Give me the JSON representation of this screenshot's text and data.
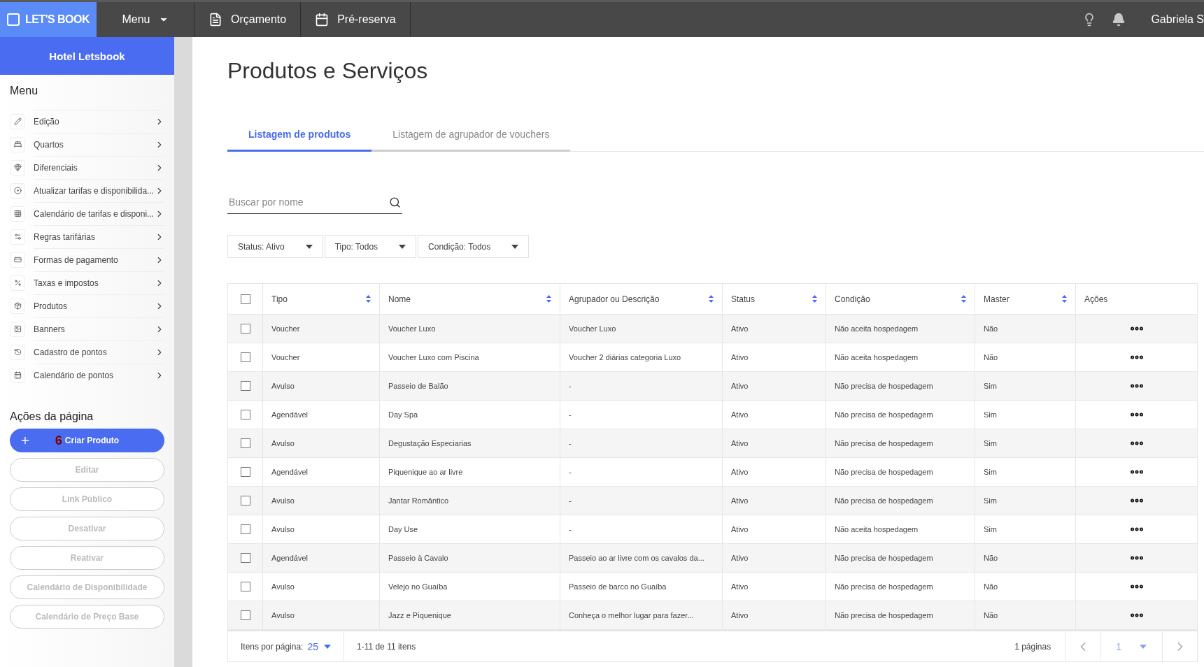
{
  "topbar": {
    "logo": "LET'S BOOK",
    "menu": "Menu",
    "nav": [
      {
        "label": "Orçamento"
      },
      {
        "label": "Pré-reserva"
      }
    ],
    "user": "Gabriela S"
  },
  "sidebar": {
    "hotel": "Hotel Letsbook",
    "menu_title": "Menu",
    "items": [
      {
        "label": "Edição"
      },
      {
        "label": "Quartos"
      },
      {
        "label": "Diferenciais"
      },
      {
        "label": "Atualizar tarifas e disponibilida..."
      },
      {
        "label": "Calendário de tarifas e disponi..."
      },
      {
        "label": "Regras tarifárias"
      },
      {
        "label": "Formas de pagamento"
      },
      {
        "label": "Taxas e impostos"
      },
      {
        "label": "Produtos"
      },
      {
        "label": "Banners"
      },
      {
        "label": "Cadastro de pontos"
      },
      {
        "label": "Calendário de pontos"
      }
    ],
    "actions_title": "Ações da página",
    "actions": [
      {
        "kind": "primary",
        "label": "Criar Produto",
        "marker": "6"
      },
      {
        "kind": "outline",
        "label": "Editar",
        "disabled": true
      },
      {
        "kind": "outline",
        "label": "Link Público",
        "disabled": true
      },
      {
        "kind": "outline",
        "label": "Desativar",
        "disabled": true
      },
      {
        "kind": "outline",
        "label": "Reativar",
        "disabled": true
      },
      {
        "kind": "outline",
        "label": "Calendário de Disponibilidade",
        "disabled": true
      },
      {
        "kind": "outline",
        "label": "Calendário de Preço Base",
        "disabled": true
      }
    ]
  },
  "page": {
    "title": "Produtos e Serviços",
    "tabs": [
      {
        "label": "Listagem de produtos",
        "selected": true
      },
      {
        "label": "Listagem de agrupador de vouchers",
        "selected": false
      }
    ],
    "search": {
      "placeholder": "Buscar por nome"
    },
    "filters": [
      {
        "label": "Status: Ativo"
      },
      {
        "label": "Tipo: Todos"
      },
      {
        "label": "Condição: Todos"
      }
    ],
    "table": {
      "columns": [
        {
          "label": "Tipo",
          "sortable": true
        },
        {
          "label": "Nome",
          "sortable": true
        },
        {
          "label": "Agrupador ou Descrição",
          "sortable": true
        },
        {
          "label": "Status",
          "sortable": true
        },
        {
          "label": "Condição",
          "sortable": true
        },
        {
          "label": "Master",
          "sortable": true
        },
        {
          "label": "Ações",
          "sortable": false
        }
      ],
      "all_checked": false,
      "rows": [
        {
          "checked": false,
          "cells": [
            "Voucher",
            "Voucher Luxo",
            "Voucher Luxo",
            "Ativo",
            "Não aceita hospedagem",
            "Não"
          ]
        },
        {
          "checked": false,
          "cells": [
            "Voucher",
            "Voucher Luxo com Piscina",
            "Voucher 2 diárias categoria Luxo",
            "Ativo",
            "Não aceita hospedagem",
            "Não"
          ]
        },
        {
          "checked": false,
          "cells": [
            "Avulso",
            "Passeio de Balão",
            "-",
            "Ativo",
            "Não precisa de hospedagem",
            "Sim"
          ]
        },
        {
          "checked": false,
          "cells": [
            "Agendável",
            "Day Spa",
            "-",
            "Ativo",
            "Não precisa de hospedagem",
            "Sim"
          ]
        },
        {
          "checked": false,
          "cells": [
            "Avulso",
            "Degustação Especiarias",
            "-",
            "Ativo",
            "Não precisa de hospedagem",
            "Sim"
          ]
        },
        {
          "checked": false,
          "cells": [
            "Agendável",
            "Piquenique ao ar livre",
            "-",
            "Ativo",
            "Não precisa de hospedagem",
            "Sim"
          ]
        },
        {
          "checked": false,
          "cells": [
            "Avulso",
            "Jantar Romântico",
            "-",
            "Ativo",
            "Não precisa de hospedagem",
            "Sim"
          ]
        },
        {
          "checked": false,
          "cells": [
            "Avulso",
            "Day Use",
            "-",
            "Ativo",
            "Não aceita hospedagem",
            "Sim"
          ]
        },
        {
          "checked": false,
          "cells": [
            "Agendável",
            "Passeio à Cavalo",
            "Passeio ao ar livre com os cavalos da...",
            "Ativo",
            "Não precisa de hospedagem",
            "Não"
          ]
        },
        {
          "checked": false,
          "cells": [
            "Avulso",
            "Velejo no Guaíba",
            "Passeio de barco no Guaíba",
            "Ativo",
            "Não precisa de hospedagem",
            "Não"
          ]
        },
        {
          "checked": false,
          "cells": [
            "Avulso",
            "Jazz e Piquenique",
            "Conheça o melhor lugar para fazer...",
            "Ativo",
            "Não precisa de hospedagem",
            "Não"
          ]
        }
      ]
    },
    "pagination": {
      "per_page_label": "Itens por página:",
      "per_page": "25",
      "range": "1-11 de 11 itens",
      "pages": "1 páginas",
      "current": "1"
    }
  }
}
